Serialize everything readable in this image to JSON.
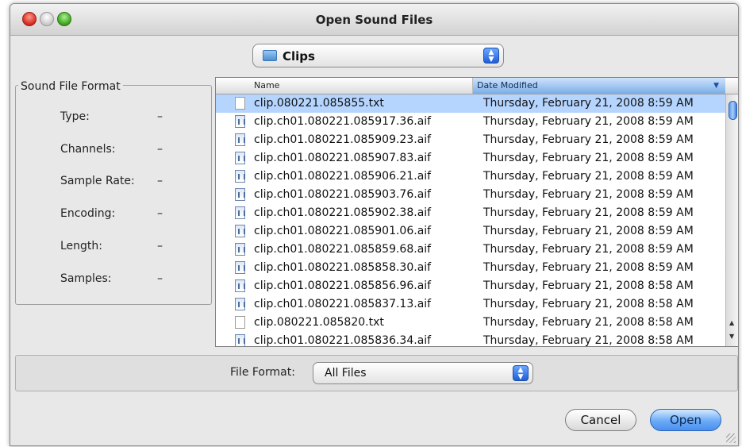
{
  "window": {
    "title": "Open Sound Files"
  },
  "folder_popup": {
    "value": "Clips",
    "icon": "folder-icon"
  },
  "sound_file_format": {
    "title": "Sound File Format",
    "properties": [
      {
        "label": "Type:",
        "value": "–"
      },
      {
        "label": "Channels:",
        "value": "–"
      },
      {
        "label": "Sample Rate:",
        "value": "–"
      },
      {
        "label": "Encoding:",
        "value": "–"
      },
      {
        "label": "Length:",
        "value": "–"
      },
      {
        "label": "Samples:",
        "value": "–"
      }
    ]
  },
  "file_list": {
    "columns": {
      "name": "Name",
      "date": "Date Modified"
    },
    "sort_indicator": "▼",
    "files": [
      {
        "name": "clip.080221.085855.txt",
        "date": "Thursday, February 21, 2008 8:59 AM",
        "kind": "txt",
        "selected": true
      },
      {
        "name": "clip.ch01.080221.085917.36.aif",
        "date": "Thursday, February 21, 2008 8:59 AM",
        "kind": "aif"
      },
      {
        "name": "clip.ch01.080221.085909.23.aif",
        "date": "Thursday, February 21, 2008 8:59 AM",
        "kind": "aif"
      },
      {
        "name": "clip.ch01.080221.085907.83.aif",
        "date": "Thursday, February 21, 2008 8:59 AM",
        "kind": "aif"
      },
      {
        "name": "clip.ch01.080221.085906.21.aif",
        "date": "Thursday, February 21, 2008 8:59 AM",
        "kind": "aif"
      },
      {
        "name": "clip.ch01.080221.085903.76.aif",
        "date": "Thursday, February 21, 2008 8:59 AM",
        "kind": "aif"
      },
      {
        "name": "clip.ch01.080221.085902.38.aif",
        "date": "Thursday, February 21, 2008 8:59 AM",
        "kind": "aif"
      },
      {
        "name": "clip.ch01.080221.085901.06.aif",
        "date": "Thursday, February 21, 2008 8:59 AM",
        "kind": "aif"
      },
      {
        "name": "clip.ch01.080221.085859.68.aif",
        "date": "Thursday, February 21, 2008 8:59 AM",
        "kind": "aif"
      },
      {
        "name": "clip.ch01.080221.085858.30.aif",
        "date": "Thursday, February 21, 2008 8:59 AM",
        "kind": "aif"
      },
      {
        "name": "clip.ch01.080221.085856.96.aif",
        "date": "Thursday, February 21, 2008 8:58 AM",
        "kind": "aif"
      },
      {
        "name": "clip.ch01.080221.085837.13.aif",
        "date": "Thursday, February 21, 2008 8:58 AM",
        "kind": "aif"
      },
      {
        "name": "clip.080221.085820.txt",
        "date": "Thursday, February 21, 2008 8:58 AM",
        "kind": "txt"
      },
      {
        "name": "clip.ch01.080221.085836.34.aif",
        "date": "Thursday, February 21, 2008 8:58 AM",
        "kind": "aif"
      }
    ]
  },
  "file_format": {
    "label": "File Format:",
    "value": "All Files"
  },
  "buttons": {
    "cancel": "Cancel",
    "open": "Open"
  },
  "colors": {
    "selection": "#b5d5ff",
    "accent": "#4b8ff0",
    "sorted_header": "#7aaee8"
  }
}
